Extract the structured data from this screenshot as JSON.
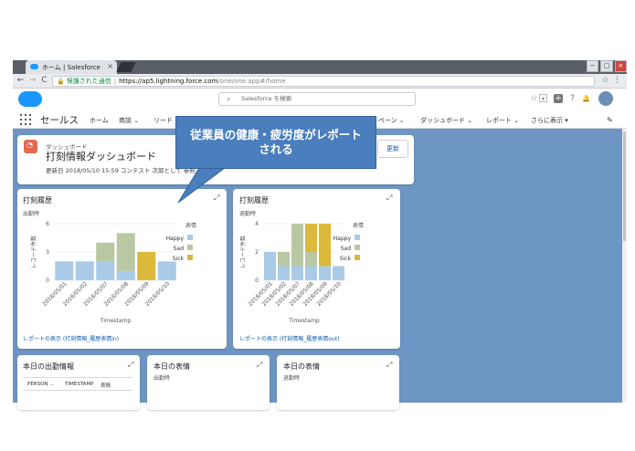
{
  "browser": {
    "tab_title": "ホーム | Salesforce",
    "tab_close": "×",
    "window_controls": [
      "−",
      "□",
      "×"
    ],
    "nav_back": "←",
    "nav_forward": "→",
    "nav_reload": "C",
    "lock_icon": "🔒",
    "secure_label": "保護された通信",
    "url_host": "https://ap5.lightning.force.com",
    "url_path": "/one/one.app#/home",
    "bookmark_icon": "☆",
    "menu_icon": "⋮"
  },
  "header": {
    "search_placeholder": "Salesforce を検索",
    "icons": [
      "☆",
      "▾",
      "+",
      "?",
      "🔔"
    ]
  },
  "nav": {
    "app_name": "セールス",
    "items": [
      {
        "label": "ホーム",
        "active": true
      },
      {
        "label": "商談 ⌄",
        "active": false
      },
      {
        "label": "リード",
        "active": false
      },
      {
        "label": "ペーン ⌄",
        "active": false
      },
      {
        "label": "ダッシュボード ⌄",
        "active": false
      },
      {
        "label": "レポート ⌄",
        "active": false
      },
      {
        "label": "さらに表示 ▾",
        "active": false
      }
    ],
    "edit_icon": "✎"
  },
  "dashboard": {
    "label": "ダッシュボード",
    "title": "打刻情報ダッシュボード",
    "meta": "更新日 2018/05/10 15:59 コンテスト 次郎として 参照",
    "refresh_label": "更新"
  },
  "callout": {
    "line1": "従業員の健康・疲労度がレポート",
    "line2": "される"
  },
  "widgets": {
    "w1": {
      "title": "打刻履歴",
      "subtitle": "出勤時",
      "link": "レポートの表示 (打刻情報_履歴表情in)",
      "expand": "⤢"
    },
    "w2": {
      "title": "打刻履歴",
      "subtitle": "退勤時",
      "link": "レポートの表示 (打刻情報_履歴表情out)",
      "expand": "⤢"
    },
    "w3": {
      "title": "本日の出勤情報",
      "expand": "⤢",
      "columns": [
        "PERSON ...",
        "TIMESTAMP",
        "表情"
      ]
    },
    "w4": {
      "title": "本日の表情",
      "subtitle": "出勤時",
      "expand": "⤢"
    },
    "w5": {
      "title": "本日の表情",
      "subtitle": "退勤時",
      "expand": "⤢"
    }
  },
  "colors": {
    "happy": "#a9cbe8",
    "sad": "#b9c8a2",
    "sick": "#dbb93a",
    "sf_blue": "#1b96ff",
    "callout": "#4a7ebc"
  },
  "chart_data": [
    {
      "type": "bar",
      "stacked": true,
      "ylabel": "レコード件数",
      "xlabel": "Timestamp",
      "legend_title": "表情",
      "legend_position": "right",
      "ylim": [
        0,
        6
      ],
      "yticks": [
        0,
        3,
        6
      ],
      "categories": [
        "2018/05/01",
        "2018/05/02",
        "2018/05/07",
        "2018/05/08",
        "2018/05/09",
        "2018/05/10"
      ],
      "series": [
        {
          "name": "Happy",
          "values": [
            2,
            2,
            2,
            1,
            0,
            2
          ]
        },
        {
          "name": "Sad",
          "values": [
            0,
            0,
            2,
            4,
            0,
            0
          ]
        },
        {
          "name": "Sick",
          "values": [
            0,
            0,
            0,
            0,
            3,
            0
          ]
        }
      ]
    },
    {
      "type": "bar",
      "stacked": true,
      "ylabel": "レコード件数",
      "xlabel": "Timestamp",
      "legend_title": "表情",
      "legend_position": "right",
      "ylim": [
        0,
        4
      ],
      "yticks": [
        0,
        2,
        4
      ],
      "categories": [
        "2018/05/01",
        "2018/05/02",
        "2018/05/07",
        "2018/05/08",
        "2018/05/09",
        "2018/05/10"
      ],
      "series": [
        {
          "name": "Happy",
          "values": [
            2,
            1,
            1,
            1,
            1,
            1
          ]
        },
        {
          "name": "Sad",
          "values": [
            0,
            1,
            3,
            1,
            0,
            0
          ]
        },
        {
          "name": "Sick",
          "values": [
            0,
            0,
            0,
            2,
            3,
            0
          ]
        }
      ]
    }
  ]
}
